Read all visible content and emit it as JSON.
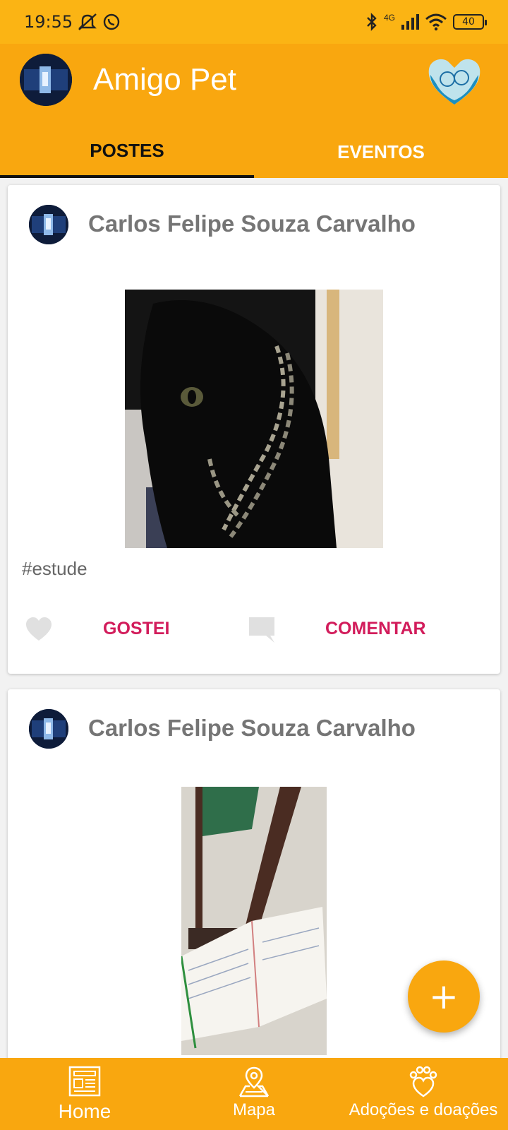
{
  "status_bar": {
    "time": "19:55",
    "network": "4G",
    "battery": "40",
    "icons": [
      "mute-icon",
      "whatsapp-icon",
      "bluetooth-icon",
      "signal-icon",
      "wifi-icon",
      "battery-icon"
    ]
  },
  "app_bar": {
    "title": "Amigo Pet",
    "logo_icon": "pet-heart-logo-icon"
  },
  "tabs": [
    {
      "label": "POSTES",
      "active": true
    },
    {
      "label": "EVENTOS",
      "active": false
    }
  ],
  "posts": [
    {
      "author": "Carlos Felipe Souza Carvalho",
      "image": "black-cat-with-chain-photo",
      "caption": "#estude",
      "like_label": "GOSTEI",
      "comment_label": "COMENTAR"
    },
    {
      "author": "Carlos Felipe Souza Carvalho",
      "image": "notebook-on-chair-photo"
    }
  ],
  "fab": {
    "icon": "plus-icon",
    "label": "+"
  },
  "bottom_nav": [
    {
      "label": "Home",
      "icon": "newspaper-icon",
      "active": true
    },
    {
      "label": "Mapa",
      "icon": "map-pin-icon",
      "active": false
    },
    {
      "label": "Adoções e doações",
      "icon": "paw-heart-icon",
      "active": false
    }
  ],
  "colors": {
    "status_bar": "#fbb414",
    "primary": "#f9a70f",
    "accent": "#d21c5b",
    "author_text": "#757575"
  }
}
